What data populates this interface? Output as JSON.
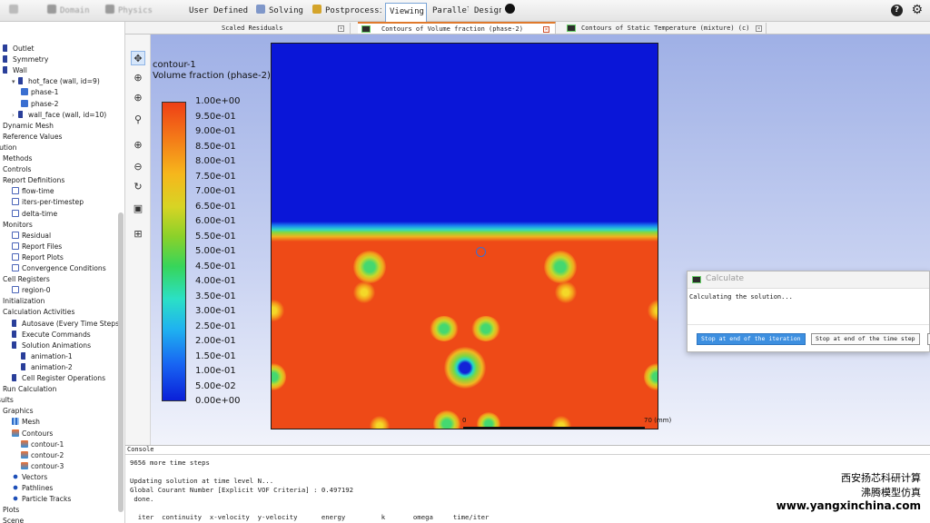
{
  "ribbon": {
    "tabs": [
      {
        "label": "Domain",
        "state": "blur",
        "icon": "domain-icon"
      },
      {
        "label": "Physics",
        "state": "blur",
        "icon": "physics-icon"
      },
      {
        "label": "User Defined",
        "state": "normal",
        "icon": "user-defined-icon"
      },
      {
        "label": "Solving",
        "state": "normal",
        "icon": "solving-icon"
      },
      {
        "label": "Postprocessing",
        "state": "normal",
        "icon": "postprocessing-icon"
      },
      {
        "label": "Viewing",
        "state": "active",
        "icon": ""
      },
      {
        "label": "Parallel",
        "state": "normal",
        "icon": ""
      },
      {
        "label": "Design",
        "state": "normal",
        "icon": ""
      }
    ],
    "help_glyph": "?",
    "settings_glyph": "⚙"
  },
  "tree": {
    "items": [
      {
        "label": "Outlet",
        "indent": 0,
        "icon": "flag"
      },
      {
        "label": "Symmetry",
        "indent": 0,
        "icon": "flag"
      },
      {
        "label": "Wall",
        "indent": 0,
        "icon": "flag"
      },
      {
        "label": "hot_face (wall, id=9)",
        "indent": 1,
        "icon": "flag",
        "caret": "▾"
      },
      {
        "label": "phase-1",
        "indent": 2,
        "icon": "face"
      },
      {
        "label": "phase-2",
        "indent": 2,
        "icon": "face"
      },
      {
        "label": "wall_face (wall, id=10)",
        "indent": 1,
        "icon": "flag",
        "caret": "›"
      },
      {
        "label": "Dynamic Mesh",
        "indent": 0,
        "icon": ""
      },
      {
        "label": "Reference Values",
        "indent": 0,
        "icon": ""
      },
      {
        "label": "lution",
        "indent": 0,
        "icon": "",
        "flush": true
      },
      {
        "label": "Methods",
        "indent": 0,
        "icon": ""
      },
      {
        "label": "Controls",
        "indent": 0,
        "icon": ""
      },
      {
        "label": "Report Definitions",
        "indent": 0,
        "icon": ""
      },
      {
        "label": "flow-time",
        "indent": 1,
        "icon": "doc"
      },
      {
        "label": "iters-per-timestep",
        "indent": 1,
        "icon": "doc"
      },
      {
        "label": "delta-time",
        "indent": 1,
        "icon": "doc"
      },
      {
        "label": "Monitors",
        "indent": 0,
        "icon": ""
      },
      {
        "label": "Residual",
        "indent": 1,
        "icon": "doc"
      },
      {
        "label": "Report Files",
        "indent": 1,
        "icon": "doc"
      },
      {
        "label": "Report Plots",
        "indent": 1,
        "icon": "doc"
      },
      {
        "label": "Convergence Conditions",
        "indent": 1,
        "icon": "doc"
      },
      {
        "label": "Cell Registers",
        "indent": 0,
        "icon": ""
      },
      {
        "label": "region-0",
        "indent": 1,
        "icon": "doc"
      },
      {
        "label": "Initialization",
        "indent": 0,
        "icon": ""
      },
      {
        "label": "Calculation Activities",
        "indent": 0,
        "icon": ""
      },
      {
        "label": "Autosave (Every Time Steps)",
        "indent": 1,
        "icon": "flag"
      },
      {
        "label": "Execute Commands",
        "indent": 1,
        "icon": "flag"
      },
      {
        "label": "Solution Animations",
        "indent": 1,
        "icon": "flag"
      },
      {
        "label": "animation-1",
        "indent": 2,
        "icon": "flag"
      },
      {
        "label": "animation-2",
        "indent": 2,
        "icon": "flag"
      },
      {
        "label": "Cell Register Operations",
        "indent": 1,
        "icon": "flag"
      },
      {
        "label": "Run Calculation",
        "indent": 0,
        "icon": ""
      },
      {
        "label": "sults",
        "indent": 0,
        "icon": "",
        "flush": true
      },
      {
        "label": "Graphics",
        "indent": 0,
        "icon": ""
      },
      {
        "label": "Mesh",
        "indent": 1,
        "icon": "grid"
      },
      {
        "label": "Contours",
        "indent": 1,
        "icon": "img"
      },
      {
        "label": "contour-1",
        "indent": 2,
        "icon": "img"
      },
      {
        "label": "contour-2",
        "indent": 2,
        "icon": "img"
      },
      {
        "label": "contour-3",
        "indent": 2,
        "icon": "img"
      },
      {
        "label": "Vectors",
        "indent": 1,
        "icon": "vec"
      },
      {
        "label": "Pathlines",
        "indent": 1,
        "icon": "vec"
      },
      {
        "label": "Particle Tracks",
        "indent": 1,
        "icon": "vec"
      },
      {
        "label": "Plots",
        "indent": 0,
        "icon": ""
      },
      {
        "label": "Scene",
        "indent": 0,
        "icon": ""
      }
    ]
  },
  "graphics_tabs": [
    {
      "label": "Scaled Residuals",
      "active": false,
      "icon": false
    },
    {
      "label": "Contours of Volume fraction (phase-2)",
      "active": true,
      "icon": true
    },
    {
      "label": "Contours of Static Temperature (mixture) (c)",
      "active": false,
      "icon": true
    }
  ],
  "toolbar": {
    "tools": [
      {
        "name": "pointer-tool-icon",
        "glyph": "✥",
        "selected": true
      },
      {
        "name": "zoom-to-fit-icon",
        "glyph": "⊕",
        "selected": false
      },
      {
        "name": "zoom-in-icon",
        "glyph": "⊕",
        "selected": false
      },
      {
        "name": "probe-tool-icon",
        "glyph": "⚲",
        "selected": false
      },
      {
        "name": "zoom-box-icon",
        "glyph": "⊕",
        "selected": false
      },
      {
        "name": "zoom-out-icon",
        "glyph": "⊖",
        "selected": false
      },
      {
        "name": "rotate-tool-icon",
        "glyph": "↻",
        "selected": false
      },
      {
        "name": "display-options-icon",
        "glyph": "▣",
        "selected": false
      },
      {
        "name": "view-menu-icon",
        "glyph": "⊞",
        "selected": false
      }
    ]
  },
  "contour": {
    "name": "contour-1",
    "quantity": "Volume fraction (phase-2)",
    "colorbar_labels": [
      "1.00e+00",
      "9.50e-01",
      "9.00e-01",
      "8.50e-01",
      "8.00e-01",
      "7.50e-01",
      "7.00e-01",
      "6.50e-01",
      "6.00e-01",
      "5.50e-01",
      "5.00e-01",
      "4.50e-01",
      "4.00e-01",
      "3.50e-01",
      "3.00e-01",
      "2.50e-01",
      "2.00e-01",
      "1.50e-01",
      "1.00e-01",
      "5.00e-02",
      "0.00e+00"
    ],
    "scale_start": "0",
    "scale_end": "70 (mm)",
    "colors": {
      "liquid": "#ee4a17",
      "vapor": "#0a16d8"
    }
  },
  "calculate_dialog": {
    "title": "Calculate",
    "message": "Calculating the solution...",
    "buttons": [
      "Stop at end of the iteration",
      "Stop at end of the time step"
    ]
  },
  "console": {
    "title": "Console",
    "lines": [
      "9656 more time steps",
      "",
      "Updating solution at time level N...",
      "Global Courant Number [Explicit VOF Criteria] : 0.497192",
      " done.",
      "",
      "  iter  continuity  x-velocity  y-velocity      energy         k       omega     time/iter"
    ]
  },
  "watermark": {
    "line1": "西安扬芯科研计算",
    "line2": "沸腾模型仿真",
    "line3": "www.yangxinchina.com"
  }
}
